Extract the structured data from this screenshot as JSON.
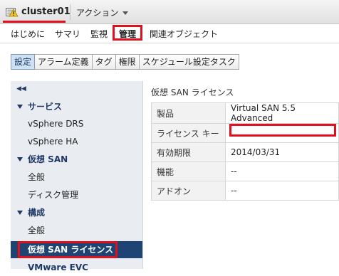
{
  "header": {
    "cluster_name": "cluster01",
    "actions_label": "アクション"
  },
  "top_tabs": [
    "はじめに",
    "サマリ",
    "監視",
    "管理",
    "関連オブジェクト"
  ],
  "sub_tabs": [
    "設定",
    "アラーム定義",
    "タグ",
    "権限",
    "スケジュール設定タスク"
  ],
  "nav": {
    "groups": [
      {
        "label": "サービス",
        "items": [
          "vSphere DRS",
          "vSphere HA"
        ]
      },
      {
        "label": "仮想 SAN",
        "items": [
          "全般",
          "ディスク管理"
        ]
      },
      {
        "label": "構成",
        "items": [
          "全般",
          "仮想 SAN ライセンス",
          "VMware EVC"
        ]
      }
    ],
    "selected": "仮想 SAN ライセンス"
  },
  "panel": {
    "title": "仮想 SAN ライセンス",
    "rows": [
      {
        "key": "製品",
        "value": "Virtual SAN 5.5 Advanced"
      },
      {
        "key": "ライセンス キー",
        "value": ""
      },
      {
        "key": "有効期限",
        "value": "2014/03/31"
      },
      {
        "key": "機能",
        "value": "--"
      },
      {
        "key": "アドオン",
        "value": "--"
      }
    ]
  },
  "colors": {
    "highlight_red": "#e0101e",
    "nav_selected_bg": "#1d4472",
    "nav_group_text": "#1f3a66",
    "active_subtab_bg": "#cfe0f2"
  }
}
